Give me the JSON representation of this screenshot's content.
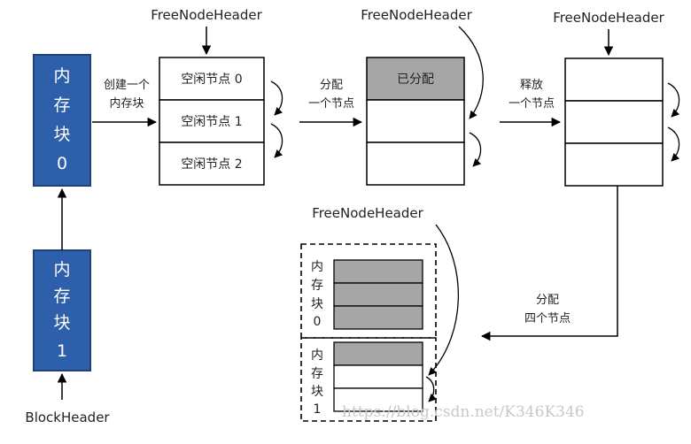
{
  "headers": {
    "h1": "FreeNodeHeader",
    "h2": "FreeNodeHeader",
    "h3": "FreeNodeHeader",
    "h4": "FreeNodeHeader",
    "block_header": "BlockHeader"
  },
  "memory_blocks": {
    "block0": [
      "内",
      "存",
      "块",
      "0"
    ],
    "block1": [
      "内",
      "存",
      "块",
      "1"
    ]
  },
  "steps": {
    "create": [
      "创建一个",
      "内存块"
    ],
    "alloc_one": [
      "分配",
      "一个节点"
    ],
    "release_one": [
      "释放",
      "一个节点"
    ],
    "alloc_four": [
      "分配",
      "四个节点"
    ]
  },
  "free_nodes": [
    "空闲节点 0",
    "空闲节点 1",
    "空闲节点 2"
  ],
  "allocated_label": "已分配",
  "dashed_labels": {
    "block0": [
      "内",
      "存",
      "块",
      "0"
    ],
    "block1": [
      "内",
      "存",
      "块",
      "1"
    ]
  },
  "watermark": "https://blog.csdn.net/K346K346",
  "colors": {
    "block_fill": "#2e5faa",
    "block_stroke": "#1f4179",
    "allocated_fill": "#a6a6a6",
    "line": "#000000"
  }
}
